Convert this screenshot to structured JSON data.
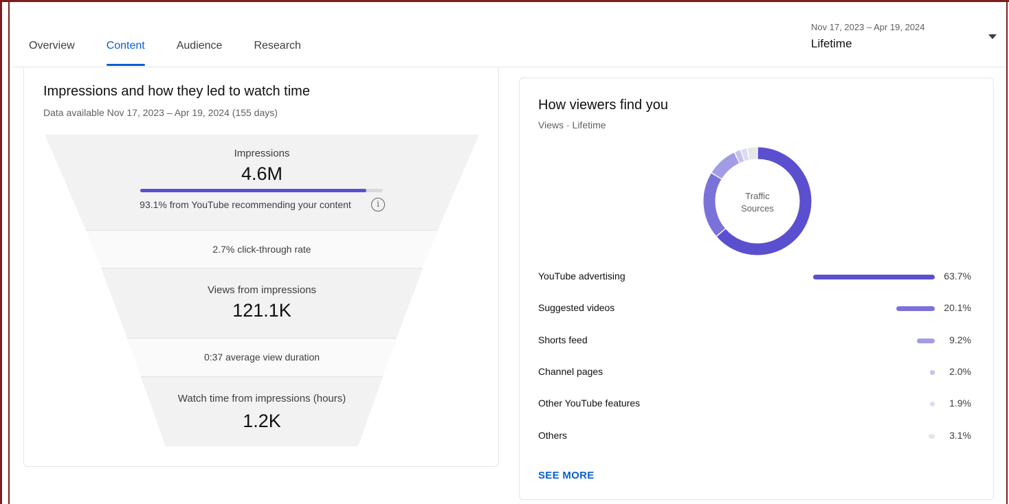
{
  "tabs": [
    {
      "label": "Overview",
      "active": false
    },
    {
      "label": "Content",
      "active": true
    },
    {
      "label": "Audience",
      "active": false
    },
    {
      "label": "Research",
      "active": false
    }
  ],
  "date_picker": {
    "range": "Nov 17, 2023 – Apr 19, 2024",
    "value": "Lifetime"
  },
  "impressions_card": {
    "title": "Impressions and how they led to watch time",
    "subtitle": "Data available Nov 17, 2023 – Apr 19, 2024 (155 days)",
    "impressions_label": "Impressions",
    "impressions_value": "4.6M",
    "recommend_pct": 93.1,
    "recommend_text": "93.1% from YouTube recommending your content",
    "ctr_text": "2.7% click-through rate",
    "views_label": "Views from impressions",
    "views_value": "121.1K",
    "avg_duration_text": "0:37 average view duration",
    "watch_label": "Watch time from impressions (hours)",
    "watch_value": "1.2K"
  },
  "traffic_card": {
    "title": "How viewers find you",
    "subtitle": "Views · Lifetime",
    "donut_line1": "Traffic",
    "donut_line2": "Sources",
    "see_more": "SEE MORE",
    "sources": [
      {
        "name": "YouTube advertising",
        "value": 63.7,
        "pct": "63.7%",
        "color": "#5a4fcf"
      },
      {
        "name": "Suggested videos",
        "value": 20.1,
        "pct": "20.1%",
        "color": "#7b72d9"
      },
      {
        "name": "Shorts feed",
        "value": 9.2,
        "pct": "9.2%",
        "color": "#a29ce6"
      },
      {
        "name": "Channel pages",
        "value": 2.0,
        "pct": "2.0%",
        "color": "#c5c1f0"
      },
      {
        "name": "Other YouTube features",
        "value": 1.9,
        "pct": "1.9%",
        "color": "#dcdaf5"
      },
      {
        "name": "Others",
        "value": 3.1,
        "pct": "3.1%",
        "color": "#e6e6e6"
      }
    ]
  }
}
